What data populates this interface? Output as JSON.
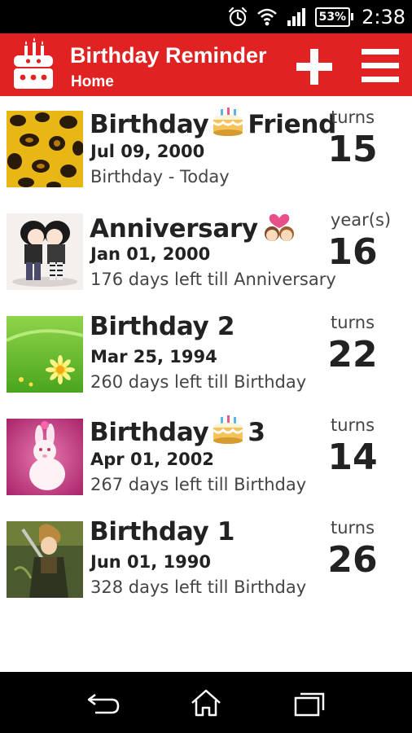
{
  "status_bar": {
    "battery": "53%",
    "time": "2:38",
    "icons": [
      "alarm-icon",
      "wifi-icon",
      "signal-icon",
      "battery-icon"
    ]
  },
  "app_bar": {
    "title": "Birthday Reminder",
    "subtitle": "Home",
    "logo": "cake-icon",
    "actions": [
      "add-icon",
      "menu-icon"
    ],
    "color": "#e02222"
  },
  "events": [
    {
      "name_before": "Birthday",
      "emoji": "cake-emoji",
      "name_after": "Friend",
      "date": "Jul 09, 2000",
      "status": "Birthday - Today",
      "label": "turns",
      "count": "15",
      "thumb": "leopard-print-thumbnail"
    },
    {
      "name_before": "Anniversary",
      "emoji": "couple-emoji",
      "name_after": "",
      "date": "Jan 01, 2000",
      "status": "176 days left till Anniversary",
      "label": "year(s)",
      "count": "16",
      "thumb": "couple-illustration-thumbnail"
    },
    {
      "name_before": "Birthday 2",
      "emoji": "",
      "name_after": "",
      "date": "Mar 25, 1994",
      "status": "260 days left till Birthday",
      "label": "turns",
      "count": "22",
      "thumb": "green-field-flower-thumbnail"
    },
    {
      "name_before": "Birthday",
      "emoji": "cake-emoji",
      "name_after": "3",
      "date": "Apr 01, 2002",
      "status": "267 days left till Birthday",
      "label": "turns",
      "count": "14",
      "thumb": "pink-bunny-thumbnail"
    },
    {
      "name_before": "Birthday 1",
      "emoji": "",
      "name_after": "",
      "date": "Jun 01, 1990",
      "status": "328 days left till Birthday",
      "label": "turns",
      "count": "26",
      "thumb": "anime-character-thumbnail"
    }
  ],
  "nav_bar": {
    "buttons": [
      "back-icon",
      "home-icon",
      "recent-apps-icon"
    ]
  }
}
